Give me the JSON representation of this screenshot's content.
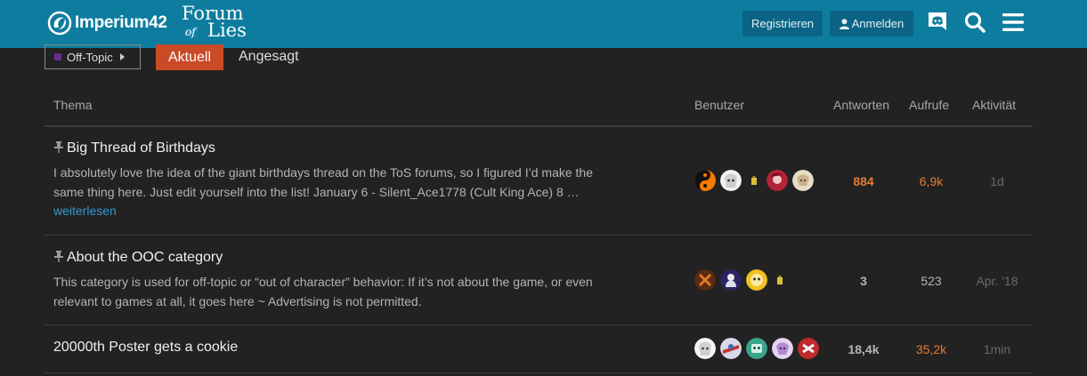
{
  "header": {
    "brand_name": "Imperium42",
    "forum_logo": {
      "line1": "Forum",
      "of": "of",
      "line2": "Lies"
    },
    "register_label": "Registrieren",
    "login_label": "Anmelden",
    "icons": [
      "discord-icon",
      "search-icon",
      "menu-icon"
    ],
    "bg_color": "#0e7c9f"
  },
  "nav": {
    "category": "Off-Topic",
    "category_color": "#652d90",
    "tabs": [
      {
        "label": "Aktuell",
        "active": true
      },
      {
        "label": "Angesagt",
        "active": false
      }
    ]
  },
  "table": {
    "columns": [
      "Thema",
      "Benutzer",
      "Antworten",
      "Aufrufe",
      "Aktivität"
    ],
    "topics": [
      {
        "title": "Big Thread of Birthdays",
        "pinned": true,
        "excerpt_line1": "I absolutely love the idea of the giant birthdays thread on the ToS forums, so I figured I’d make the",
        "excerpt_line2": "same thing here. Just edit yourself into the list! January 6 - Silent_Ace1778 (Cult King Ace) 8 …",
        "read_more": "weiterlesen",
        "replies": "884",
        "views": "6,9k",
        "activity": "1d"
      },
      {
        "title": "About the OOC category",
        "pinned": true,
        "excerpt_line1": "This category is used for off-topic or “out of character” behavior: If it’s not about the game, or even",
        "excerpt_line2": "relevant to games at all, it goes here ~ Advertising is not permitted.",
        "replies": "3",
        "views": "523",
        "activity": "Apr. '18"
      },
      {
        "title": "20000th Poster gets a cookie",
        "pinned": false,
        "replies": "18,4k",
        "views": "35,2k",
        "activity": "1min"
      }
    ]
  }
}
